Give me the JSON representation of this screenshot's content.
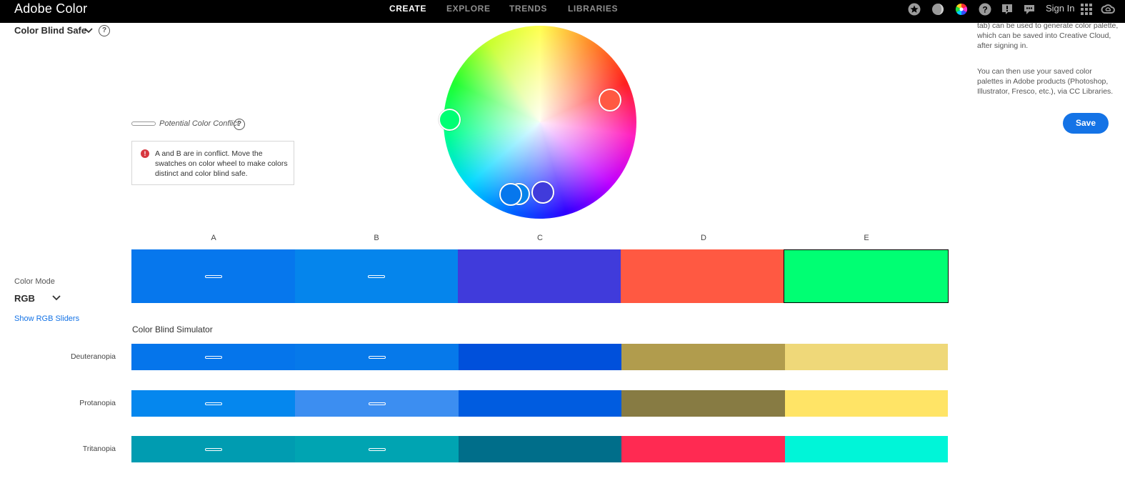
{
  "app": {
    "title": "Adobe Color"
  },
  "nav": [
    {
      "label": "CREATE",
      "active": true
    },
    {
      "label": "EXPLORE",
      "active": false
    },
    {
      "label": "TRENDS",
      "active": false
    },
    {
      "label": "LIBRARIES",
      "active": false
    }
  ],
  "topbar": {
    "icons": [
      "star-icon",
      "contrast-icon",
      "color-wheel-icon",
      "help-icon",
      "alert-icon",
      "chat-icon"
    ],
    "sign_in": "Sign In",
    "apps_icon": "apps-grid-icon",
    "cc_icon": "creative-cloud-icon"
  },
  "harmony": {
    "value": "Color Blind Safe"
  },
  "conflict": {
    "legend": "Potential Color Conflict",
    "message": "A and B are in conflict. Move the swatches on color wheel to make colors distinct and color blind safe."
  },
  "right_panel": {
    "para1": "tab) can be used to generate color palette, which can be saved into Creative Cloud, after signing in.",
    "para2": "You can then use your saved color palettes in Adobe products (Photoshop, Illustrator, Fresco, etc.), via CC Libraries.",
    "save_label": "Save"
  },
  "color_mode": {
    "label": "Color Mode",
    "value": "RGB",
    "show_sliders": "Show RGB Sliders"
  },
  "swatches": [
    {
      "letter": "A",
      "color": "#0677ED",
      "conflict": true
    },
    {
      "letter": "B",
      "color": "#0585EC",
      "conflict": true
    },
    {
      "letter": "C",
      "color": "#403BDB",
      "conflict": false
    },
    {
      "letter": "D",
      "color": "#FF5942",
      "conflict": false
    },
    {
      "letter": "E",
      "color": "#00FF73",
      "conflict": false,
      "selected": true
    }
  ],
  "simulator": {
    "title": "Color Blind Simulator",
    "rows": [
      {
        "label": "Deuteranopia",
        "colors": [
          "#0575EB",
          "#0679EA",
          "#0050DB",
          "#B19C4D",
          "#EFD879"
        ],
        "conflicts": [
          true,
          true,
          false,
          false,
          false
        ]
      },
      {
        "label": "Protanopia",
        "colors": [
          "#0587EE",
          "#3C8EF1",
          "#005CE0",
          "#877B43",
          "#FFE466"
        ],
        "conflicts": [
          true,
          true,
          false,
          false,
          false
        ]
      },
      {
        "label": "Tritanopia",
        "colors": [
          "#009CB1",
          "#00A4B2",
          "#006E8A",
          "#FF2A52",
          "#00F5D8"
        ],
        "conflicts": [
          true,
          true,
          false,
          false,
          false
        ]
      }
    ]
  },
  "wheel_handles": [
    {
      "name": "handle-a",
      "color": "#0677ED"
    },
    {
      "name": "handle-b",
      "color": "#0585EC"
    },
    {
      "name": "handle-c",
      "color": "#403BDB"
    },
    {
      "name": "handle-d",
      "color": "#FF5942"
    },
    {
      "name": "handle-e",
      "color": "#00FF73"
    }
  ]
}
